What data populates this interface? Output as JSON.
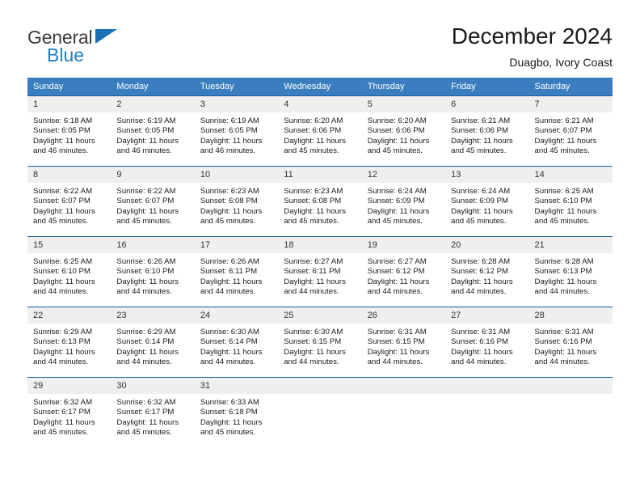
{
  "logo": {
    "word_one": "General",
    "word_two": "Blue",
    "triangle_icon": "triangle-icon",
    "brand_blue": "#1a6fb5",
    "brand_gray": "#3b3b3b"
  },
  "header": {
    "title": "December 2024",
    "subtitle": "Duagbo, Ivory Coast"
  },
  "calendar": {
    "header_bg": "#3a7ebf",
    "row_border": "#1c5f9e",
    "daynum_bg": "#efefef",
    "weekday_headers": [
      "Sunday",
      "Monday",
      "Tuesday",
      "Wednesday",
      "Thursday",
      "Friday",
      "Saturday"
    ],
    "weeks": [
      [
        {
          "day": "1",
          "sunrise": "Sunrise: 6:18 AM",
          "sunset": "Sunset: 6:05 PM",
          "daylight_line1": "Daylight: 11 hours",
          "daylight_line2": "and 46 minutes."
        },
        {
          "day": "2",
          "sunrise": "Sunrise: 6:19 AM",
          "sunset": "Sunset: 6:05 PM",
          "daylight_line1": "Daylight: 11 hours",
          "daylight_line2": "and 46 minutes."
        },
        {
          "day": "3",
          "sunrise": "Sunrise: 6:19 AM",
          "sunset": "Sunset: 6:05 PM",
          "daylight_line1": "Daylight: 11 hours",
          "daylight_line2": "and 46 minutes."
        },
        {
          "day": "4",
          "sunrise": "Sunrise: 6:20 AM",
          "sunset": "Sunset: 6:06 PM",
          "daylight_line1": "Daylight: 11 hours",
          "daylight_line2": "and 45 minutes."
        },
        {
          "day": "5",
          "sunrise": "Sunrise: 6:20 AM",
          "sunset": "Sunset: 6:06 PM",
          "daylight_line1": "Daylight: 11 hours",
          "daylight_line2": "and 45 minutes."
        },
        {
          "day": "6",
          "sunrise": "Sunrise: 6:21 AM",
          "sunset": "Sunset: 6:06 PM",
          "daylight_line1": "Daylight: 11 hours",
          "daylight_line2": "and 45 minutes."
        },
        {
          "day": "7",
          "sunrise": "Sunrise: 6:21 AM",
          "sunset": "Sunset: 6:07 PM",
          "daylight_line1": "Daylight: 11 hours",
          "daylight_line2": "and 45 minutes."
        }
      ],
      [
        {
          "day": "8",
          "sunrise": "Sunrise: 6:22 AM",
          "sunset": "Sunset: 6:07 PM",
          "daylight_line1": "Daylight: 11 hours",
          "daylight_line2": "and 45 minutes."
        },
        {
          "day": "9",
          "sunrise": "Sunrise: 6:22 AM",
          "sunset": "Sunset: 6:07 PM",
          "daylight_line1": "Daylight: 11 hours",
          "daylight_line2": "and 45 minutes."
        },
        {
          "day": "10",
          "sunrise": "Sunrise: 6:23 AM",
          "sunset": "Sunset: 6:08 PM",
          "daylight_line1": "Daylight: 11 hours",
          "daylight_line2": "and 45 minutes."
        },
        {
          "day": "11",
          "sunrise": "Sunrise: 6:23 AM",
          "sunset": "Sunset: 6:08 PM",
          "daylight_line1": "Daylight: 11 hours",
          "daylight_line2": "and 45 minutes."
        },
        {
          "day": "12",
          "sunrise": "Sunrise: 6:24 AM",
          "sunset": "Sunset: 6:09 PM",
          "daylight_line1": "Daylight: 11 hours",
          "daylight_line2": "and 45 minutes."
        },
        {
          "day": "13",
          "sunrise": "Sunrise: 6:24 AM",
          "sunset": "Sunset: 6:09 PM",
          "daylight_line1": "Daylight: 11 hours",
          "daylight_line2": "and 45 minutes."
        },
        {
          "day": "14",
          "sunrise": "Sunrise: 6:25 AM",
          "sunset": "Sunset: 6:10 PM",
          "daylight_line1": "Daylight: 11 hours",
          "daylight_line2": "and 45 minutes."
        }
      ],
      [
        {
          "day": "15",
          "sunrise": "Sunrise: 6:25 AM",
          "sunset": "Sunset: 6:10 PM",
          "daylight_line1": "Daylight: 11 hours",
          "daylight_line2": "and 44 minutes."
        },
        {
          "day": "16",
          "sunrise": "Sunrise: 6:26 AM",
          "sunset": "Sunset: 6:10 PM",
          "daylight_line1": "Daylight: 11 hours",
          "daylight_line2": "and 44 minutes."
        },
        {
          "day": "17",
          "sunrise": "Sunrise: 6:26 AM",
          "sunset": "Sunset: 6:11 PM",
          "daylight_line1": "Daylight: 11 hours",
          "daylight_line2": "and 44 minutes."
        },
        {
          "day": "18",
          "sunrise": "Sunrise: 6:27 AM",
          "sunset": "Sunset: 6:11 PM",
          "daylight_line1": "Daylight: 11 hours",
          "daylight_line2": "and 44 minutes."
        },
        {
          "day": "19",
          "sunrise": "Sunrise: 6:27 AM",
          "sunset": "Sunset: 6:12 PM",
          "daylight_line1": "Daylight: 11 hours",
          "daylight_line2": "and 44 minutes."
        },
        {
          "day": "20",
          "sunrise": "Sunrise: 6:28 AM",
          "sunset": "Sunset: 6:12 PM",
          "daylight_line1": "Daylight: 11 hours",
          "daylight_line2": "and 44 minutes."
        },
        {
          "day": "21",
          "sunrise": "Sunrise: 6:28 AM",
          "sunset": "Sunset: 6:13 PM",
          "daylight_line1": "Daylight: 11 hours",
          "daylight_line2": "and 44 minutes."
        }
      ],
      [
        {
          "day": "22",
          "sunrise": "Sunrise: 6:29 AM",
          "sunset": "Sunset: 6:13 PM",
          "daylight_line1": "Daylight: 11 hours",
          "daylight_line2": "and 44 minutes."
        },
        {
          "day": "23",
          "sunrise": "Sunrise: 6:29 AM",
          "sunset": "Sunset: 6:14 PM",
          "daylight_line1": "Daylight: 11 hours",
          "daylight_line2": "and 44 minutes."
        },
        {
          "day": "24",
          "sunrise": "Sunrise: 6:30 AM",
          "sunset": "Sunset: 6:14 PM",
          "daylight_line1": "Daylight: 11 hours",
          "daylight_line2": "and 44 minutes."
        },
        {
          "day": "25",
          "sunrise": "Sunrise: 6:30 AM",
          "sunset": "Sunset: 6:15 PM",
          "daylight_line1": "Daylight: 11 hours",
          "daylight_line2": "and 44 minutes."
        },
        {
          "day": "26",
          "sunrise": "Sunrise: 6:31 AM",
          "sunset": "Sunset: 6:15 PM",
          "daylight_line1": "Daylight: 11 hours",
          "daylight_line2": "and 44 minutes."
        },
        {
          "day": "27",
          "sunrise": "Sunrise: 6:31 AM",
          "sunset": "Sunset: 6:16 PM",
          "daylight_line1": "Daylight: 11 hours",
          "daylight_line2": "and 44 minutes."
        },
        {
          "day": "28",
          "sunrise": "Sunrise: 6:31 AM",
          "sunset": "Sunset: 6:16 PM",
          "daylight_line1": "Daylight: 11 hours",
          "daylight_line2": "and 44 minutes."
        }
      ],
      [
        {
          "day": "29",
          "sunrise": "Sunrise: 6:32 AM",
          "sunset": "Sunset: 6:17 PM",
          "daylight_line1": "Daylight: 11 hours",
          "daylight_line2": "and 45 minutes."
        },
        {
          "day": "30",
          "sunrise": "Sunrise: 6:32 AM",
          "sunset": "Sunset: 6:17 PM",
          "daylight_line1": "Daylight: 11 hours",
          "daylight_line2": "and 45 minutes."
        },
        {
          "day": "31",
          "sunrise": "Sunrise: 6:33 AM",
          "sunset": "Sunset: 6:18 PM",
          "daylight_line1": "Daylight: 11 hours",
          "daylight_line2": "and 45 minutes."
        },
        {
          "day": "",
          "sunrise": "",
          "sunset": "",
          "daylight_line1": "",
          "daylight_line2": ""
        },
        {
          "day": "",
          "sunrise": "",
          "sunset": "",
          "daylight_line1": "",
          "daylight_line2": ""
        },
        {
          "day": "",
          "sunrise": "",
          "sunset": "",
          "daylight_line1": "",
          "daylight_line2": ""
        },
        {
          "day": "",
          "sunrise": "",
          "sunset": "",
          "daylight_line1": "",
          "daylight_line2": ""
        }
      ]
    ]
  }
}
